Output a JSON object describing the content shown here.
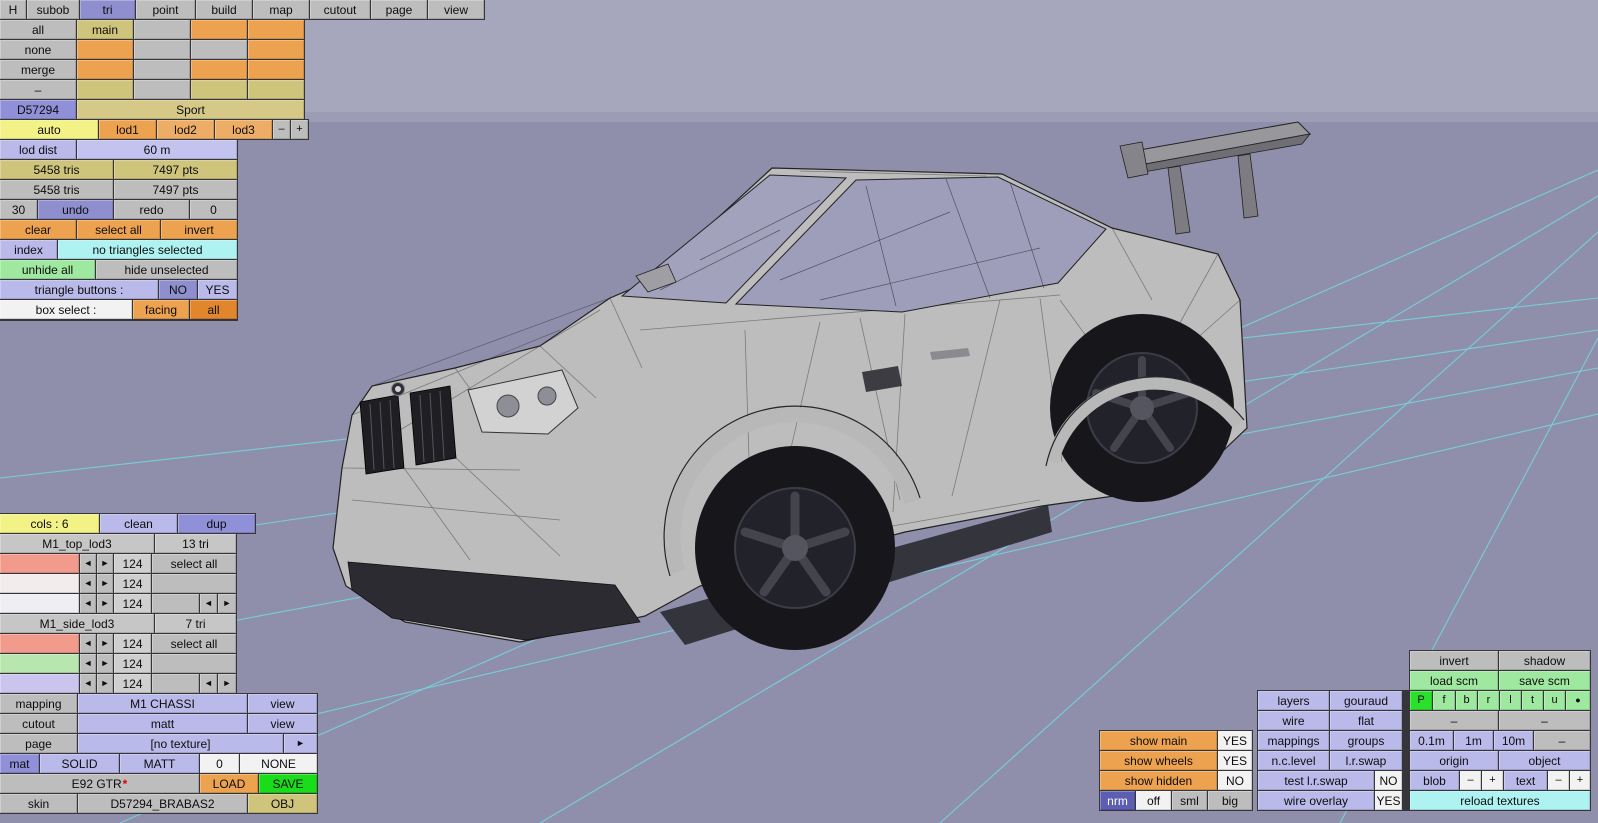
{
  "colors": {
    "viewport_bg": "#8f8fab",
    "grid_line": "#6fe4e8",
    "accent_orange": "#eda24f",
    "accent_lavender": "#b9b9ea",
    "accent_cyan": "#aef2f2",
    "accent_green": "#9fe89f",
    "save_green": "#18dd18",
    "selected_blue": "#8f8fd0"
  },
  "topbar": {
    "items": [
      "H",
      "subob",
      "tri",
      "point",
      "build",
      "map",
      "cutout",
      "page",
      "view"
    ]
  },
  "subobj": {
    "row_labels": [
      "all",
      "none",
      "merge",
      "–"
    ],
    "main_label": "main",
    "id": "D57294",
    "name": "Sport"
  },
  "lod": {
    "auto": "auto",
    "lod1": "lod1",
    "lod2": "lod2",
    "lod3": "lod3",
    "minus": "–",
    "plus": "+",
    "dist_label": "lod dist",
    "dist_value": "60 m"
  },
  "stats": {
    "row1_tris": "5458 tris",
    "row1_pts": "7497 pts",
    "row2_tris": "5458 tris",
    "row2_pts": "7497 pts",
    "undo_count": "30",
    "undo": "undo",
    "redo": "redo",
    "redo_count": "0"
  },
  "selection": {
    "clear": "clear",
    "select_all": "select all",
    "invert": "invert",
    "index": "index",
    "status": "no triangles selected",
    "unhide_all": "unhide all",
    "hide_unselected": "hide unselected",
    "triangle_buttons": "triangle buttons :",
    "no": "NO",
    "yes": "YES",
    "box_select": "box select :",
    "facing": "facing",
    "all": "all"
  },
  "palette": {
    "cols": "cols : 6",
    "clean": "clean",
    "dup": "dup",
    "left": "◄",
    "right": "►",
    "groups": [
      {
        "name": "M1_top_lod3",
        "count": "13 tri",
        "select_all": "select all",
        "values": [
          "124",
          "124",
          "124"
        ]
      },
      {
        "name": "M1_side_lod3",
        "count": "7 tri",
        "select_all": "select all",
        "values": [
          "124",
          "124",
          "124"
        ]
      }
    ]
  },
  "bottom": {
    "mapping_label": "mapping",
    "mapping_value": "M1 CHASSI",
    "mapping_view": "view",
    "cutout_label": "cutout",
    "cutout_value": "matt",
    "cutout_view": "view",
    "page_label": "page",
    "page_value": "[no texture]",
    "page_next": "►",
    "mat_label": "mat",
    "solid": "SOLID",
    "matt": "MATT",
    "zero": "0",
    "none": "NONE",
    "file_name": "E92 GTR",
    "file_star": "*",
    "load": "LOAD",
    "save": "SAVE",
    "skin_label": "skin",
    "skin_value": "D57294_BRABAS2",
    "obj": "OBJ"
  },
  "right": {
    "invert": "invert",
    "shadow": "shadow",
    "load_scm": "load scm",
    "save_scm": "save scm",
    "layers": "layers",
    "gouraud": "gouraud",
    "letters": [
      "P",
      "f",
      "b",
      "r",
      "l",
      "t",
      "u",
      "●"
    ],
    "wire": "wire",
    "flat": "flat",
    "dash": "–",
    "show_main": "show main",
    "show_main_val": "YES",
    "show_wheels": "show wheels",
    "show_wheels_val": "YES",
    "show_hidden": "show hidden",
    "show_hidden_val": "NO",
    "mappings": "mappings",
    "groups": "groups",
    "nc_level": "n.c.level",
    "lr_swap": "l.r.swap",
    "test_lr_swap": "test l.r.swap",
    "test_lr_swap_val": "NO",
    "sizes": [
      "0.1m",
      "1m",
      "10m"
    ],
    "origin": "origin",
    "object": "object",
    "blob": "blob",
    "minus": "–",
    "plus": "+",
    "text": "text",
    "nrm": "nrm",
    "off": "off",
    "sml": "sml",
    "big": "big",
    "wire_overlay": "wire overlay",
    "wire_overlay_val": "YES",
    "reload_textures": "reload textures"
  }
}
